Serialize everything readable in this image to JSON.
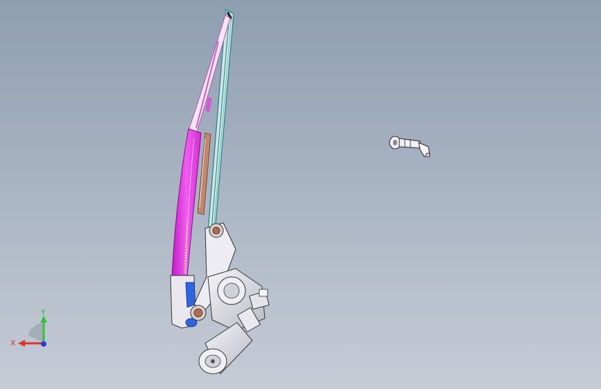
{
  "viewport": {
    "background_top": "#8e9eb1",
    "background_bottom": "#c6ccd6"
  },
  "model": {
    "parts": [
      {
        "name": "wiper-blade",
        "color": "#1f7f86"
      },
      {
        "name": "wiper-arm-cover",
        "color": "#e83ae6"
      },
      {
        "name": "arm-inner-spring",
        "color": "#c1876f"
      },
      {
        "name": "drive-pivot",
        "color": "#b26a55"
      },
      {
        "name": "wiper-motor",
        "color": "#e3e3ea"
      },
      {
        "name": "spray-nozzle",
        "color": "#e3e3ea"
      },
      {
        "name": "arm-pivot-cap",
        "color": "#2f65e0"
      }
    ]
  },
  "triad": {
    "x_label": "X",
    "y_label": "Y",
    "x_color": "#e0302b",
    "y_color": "#31c23a",
    "z_color": "#2a3fd8"
  }
}
